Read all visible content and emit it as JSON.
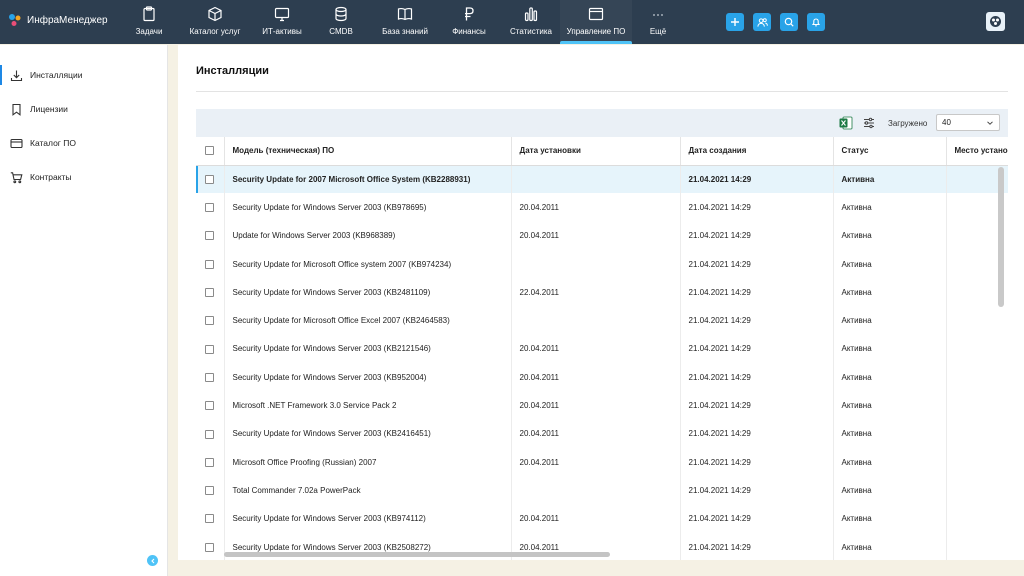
{
  "app": {
    "name": "ИнфраМенеджер"
  },
  "nav": [
    {
      "label": "Задачи",
      "icon": "clipboard-icon"
    },
    {
      "label": "Каталог услуг",
      "icon": "cube-icon"
    },
    {
      "label": "ИТ-активы",
      "icon": "monitor-icon"
    },
    {
      "label": "CMDB",
      "icon": "database-icon"
    },
    {
      "label": "База знаний",
      "icon": "book-icon"
    },
    {
      "label": "Финансы",
      "icon": "ruble-icon"
    },
    {
      "label": "Статистика",
      "icon": "bar-chart-icon"
    },
    {
      "label": "Управление ПО",
      "icon": "window-icon"
    },
    {
      "label": "Ещё",
      "icon": "more-dots-icon"
    }
  ],
  "nav_active": "Управление ПО",
  "top_actions": [
    "plus-icon",
    "users-icon",
    "search-icon",
    "bell-icon"
  ],
  "sidebar": {
    "items": [
      {
        "label": "Инсталляции",
        "icon": "download-icon",
        "active": true
      },
      {
        "label": "Лицензии",
        "icon": "bookmark-icon",
        "active": false
      },
      {
        "label": "Каталог ПО",
        "icon": "card-icon",
        "active": false
      },
      {
        "label": "Контракты",
        "icon": "cart-icon",
        "active": false
      }
    ]
  },
  "page": {
    "title": "Инсталляции"
  },
  "toolbar": {
    "loaded_label": "Загружено",
    "page_size": "40"
  },
  "table": {
    "columns": [
      "Модель (техническая) ПО",
      "Дата установки",
      "Дата создания",
      "Статус",
      "Место установки"
    ],
    "rows": [
      [
        "Security Update for 2007 Microsoft Office System (KB2288931)",
        "",
        "21.04.2021 14:29",
        "Активна",
        ""
      ],
      [
        "Security Update for Windows Server 2003 (KB978695)",
        "20.04.2011",
        "21.04.2021 14:29",
        "Активна",
        ""
      ],
      [
        "Update for Windows Server 2003 (KB968389)",
        "20.04.2011",
        "21.04.2021 14:29",
        "Активна",
        ""
      ],
      [
        "Security Update for Microsoft Office system 2007 (KB974234)",
        "",
        "21.04.2021 14:29",
        "Активна",
        ""
      ],
      [
        "Security Update for Windows Server 2003 (KB2481109)",
        "22.04.2011",
        "21.04.2021 14:29",
        "Активна",
        ""
      ],
      [
        "Security Update for Microsoft Office Excel 2007 (KB2464583)",
        "",
        "21.04.2021 14:29",
        "Активна",
        ""
      ],
      [
        "Security Update for Windows Server 2003 (KB2121546)",
        "20.04.2011",
        "21.04.2021 14:29",
        "Активна",
        ""
      ],
      [
        "Security Update for Windows Server 2003 (KB952004)",
        "20.04.2011",
        "21.04.2021 14:29",
        "Активна",
        ""
      ],
      [
        "Microsoft .NET Framework 3.0 Service Pack 2",
        "20.04.2011",
        "21.04.2021 14:29",
        "Активна",
        ""
      ],
      [
        "Security Update for Windows Server 2003 (KB2416451)",
        "20.04.2011",
        "21.04.2021 14:29",
        "Активна",
        ""
      ],
      [
        "Microsoft Office Proofing (Russian) 2007",
        "20.04.2011",
        "21.04.2021 14:29",
        "Активна",
        ""
      ],
      [
        "Total Commander 7.02a PowerPack",
        "",
        "21.04.2021 14:29",
        "Активна",
        ""
      ],
      [
        "Security Update for Windows Server 2003 (KB974112)",
        "20.04.2011",
        "21.04.2021 14:29",
        "Активна",
        ""
      ],
      [
        "Security Update for Windows Server 2003 (KB2508272)",
        "20.04.2011",
        "21.04.2021 14:29",
        "Активна",
        ""
      ]
    ],
    "selected_row": 0
  },
  "colors": {
    "topbar": "#2d3e50",
    "accent": "#29a3e8",
    "selected_row": "#e6f4fb",
    "toolbar_bg": "#eaf0f6"
  }
}
